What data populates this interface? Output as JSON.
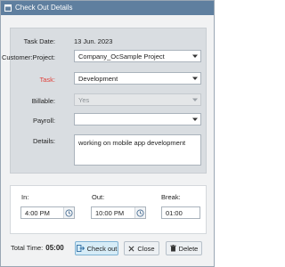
{
  "window": {
    "title": "Check Out Details"
  },
  "form": {
    "task_date_label": "Task Date:",
    "task_date_value": "13 Jun. 2023",
    "customer_project_label": "Customer:Project:",
    "customer_project_value": "Company_OcSample Project",
    "task_label": "Task:",
    "task_value": "Development",
    "billable_label": "Billable:",
    "billable_value": "Yes",
    "payroll_label": "Payroll:",
    "payroll_value": "",
    "details_label": "Details:",
    "details_value": "working on mobile app development"
  },
  "time": {
    "in_label": "In:",
    "in_value": "4:00 PM",
    "out_label": "Out:",
    "out_value": "10:00 PM",
    "break_label": "Break:",
    "break_value": "01:00"
  },
  "footer": {
    "total_time_label": "Total Time:",
    "total_time_value": "05:00",
    "checkout_label": "Check out",
    "close_label": "Close",
    "delete_label": "Delete"
  },
  "colors": {
    "titlebar": "#5f7f9f",
    "required_label": "#e0403a",
    "primary_button": "#d6ecf7"
  },
  "icons": {
    "app": "window-icon",
    "dropdown": "chevron-down-icon",
    "clock": "clock-icon",
    "checkout": "checkout-icon",
    "close": "close-icon",
    "delete": "trash-icon"
  }
}
